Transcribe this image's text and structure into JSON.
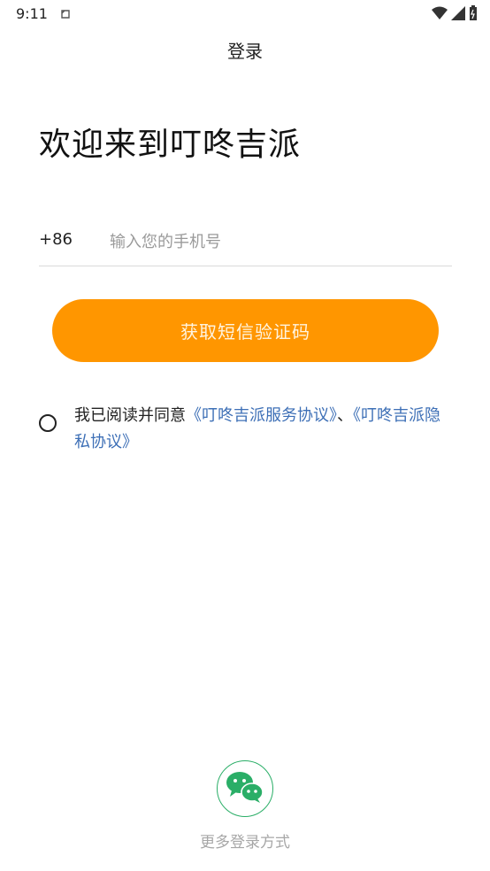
{
  "status_bar": {
    "time": "9:11"
  },
  "nav": {
    "title": "登录"
  },
  "welcome": {
    "text": "欢迎来到叮咚吉派"
  },
  "phone": {
    "country_code": "+86",
    "placeholder": "输入您的手机号"
  },
  "sms_button": {
    "label": "获取短信验证码"
  },
  "agreement": {
    "prefix": "我已阅读并同意",
    "service_link": "《叮咚吉派服务协议》",
    "separator": "、",
    "privacy_link": "《叮咚吉派隐私协议》"
  },
  "more_login": {
    "label": "更多登录方式",
    "icon": "wechat-icon"
  },
  "colors": {
    "accent": "#ff9600",
    "link": "#3d6fb6",
    "wechat": "#2aae67"
  }
}
